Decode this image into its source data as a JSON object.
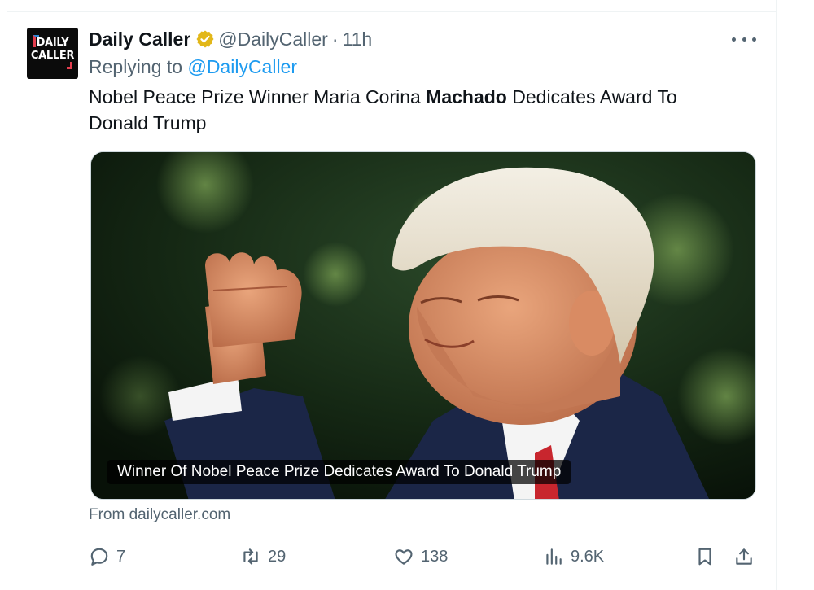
{
  "tweet": {
    "avatar_text": "DAILY\nCALLER",
    "display_name": "Daily Caller",
    "verified_icon": "verified-badge-icon",
    "handle": "@DailyCaller",
    "separator": "·",
    "time": "11h",
    "replying_prefix": "Replying to",
    "replying_handle": "@DailyCaller",
    "text_before": "Nobel Peace Prize Winner Maria Corina ",
    "text_bold": "Machado",
    "text_after": " Dedicates Award To Donald Trump",
    "card": {
      "caption": "Winner Of Nobel Peace Prize Dedicates Award To Donald Trump",
      "source": "From dailycaller.com"
    },
    "actions": {
      "replies": "7",
      "reposts": "29",
      "likes": "138",
      "views": "9.6K"
    }
  },
  "colors": {
    "text": "#0f1419",
    "secondary": "#536471",
    "link": "#1d9bf0",
    "verified_gold": "#e2b719"
  },
  "icons": [
    "more-icon",
    "reply-icon",
    "repost-icon",
    "like-icon",
    "views-icon",
    "bookmark-icon",
    "share-icon"
  ]
}
